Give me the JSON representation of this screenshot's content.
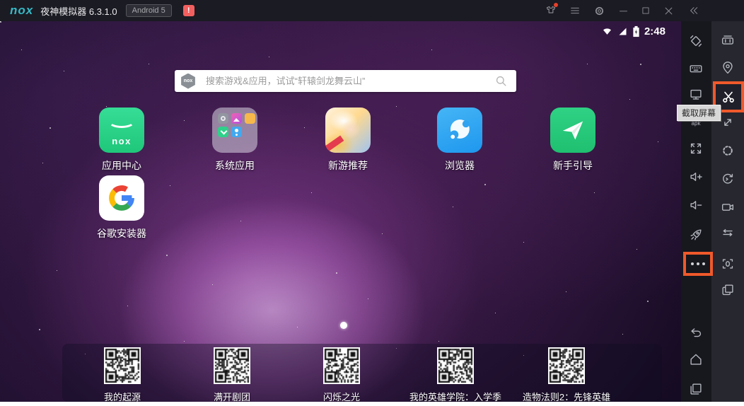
{
  "titlebar": {
    "logo_text": "nox",
    "title": "夜神模拟器 6.3.1.0",
    "android_badge": "Android 5",
    "alert_badge": "!"
  },
  "statusbar": {
    "time": "2:48"
  },
  "search": {
    "badge_text": "nox",
    "placeholder": "搜索游戏&应用，试试“轩辕剑龙舞云山”"
  },
  "apps": [
    {
      "label": "应用中心",
      "icon_text": "nox"
    },
    {
      "label": "系统应用"
    },
    {
      "label": "新游推荐"
    },
    {
      "label": "浏览器"
    },
    {
      "label": "新手引导"
    },
    {
      "label": "谷歌安装器"
    }
  ],
  "dock": {
    "items": [
      {
        "label": "我的起源"
      },
      {
        "label": "满开剧团"
      },
      {
        "label": "闪烁之光"
      },
      {
        "label": "我的英雄学院：入学季"
      },
      {
        "label": "造物法则2：先锋英雄"
      }
    ]
  },
  "sidebar": {
    "tooltip": "截取屏幕",
    "apk_label": "apk"
  },
  "colors": {
    "accent_orange": "#f0592b",
    "nox_teal": "#35b9c6",
    "titlebar_bg": "#1b1b23",
    "sidebar_left_bg": "#17171e",
    "sidebar_right_bg": "#27272f",
    "appcenter_green": "#2ad487",
    "browser_blue": "#2fa3f0",
    "guide_green": "#27c97a"
  }
}
